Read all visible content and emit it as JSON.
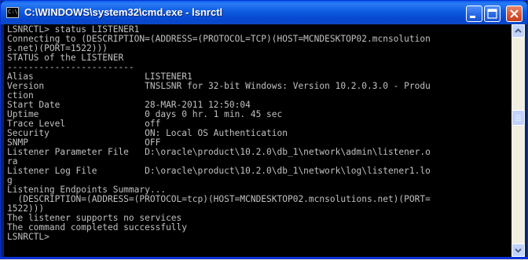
{
  "window": {
    "title": "C:\\WINDOWS\\system32\\cmd.exe - lsnrctl",
    "icon_text": "C:\\"
  },
  "console": {
    "lines": [
      "LSNRCTL> status LISTENER1",
      "Connecting to (DESCRIPTION=(ADDRESS=(PROTOCOL=TCP)(HOST=MCNDESKTOP02.mcnsolution",
      "s.net)(PORT=1522)))",
      "STATUS of the LISTENER",
      "------------------------",
      "Alias                     LISTENER1",
      "Version                   TNSLSNR for 32-bit Windows: Version 10.2.0.3.0 - Produ",
      "ction",
      "Start Date                28-MAR-2011 12:50:04",
      "Uptime                    0 days 0 hr. 1 min. 45 sec",
      "Trace Level               off",
      "Security                  ON: Local OS Authentication",
      "SNMP                      OFF",
      "Listener Parameter File   D:\\oracle\\product\\10.2.0\\db_1\\network\\admin\\listener.o",
      "ra",
      "Listener Log File         D:\\oracle\\product\\10.2.0\\db_1\\network\\log\\listener1.lo",
      "g",
      "Listening Endpoints Summary...",
      "  (DESCRIPTION=(ADDRESS=(PROTOCOL=tcp)(HOST=MCNDESKTOP02.mcnsolutions.net)(PORT=",
      "1522)))",
      "The listener supports no services",
      "The command completed successfully",
      "LSNRCTL>"
    ]
  },
  "colors": {
    "titlebar": "#0a5fe9",
    "console_bg": "#000000",
    "console_fg": "#c0c0c0"
  },
  "icons": {
    "minimize": "minimize-icon",
    "maximize": "maximize-icon",
    "close": "close-icon",
    "window": "cmd-icon"
  }
}
